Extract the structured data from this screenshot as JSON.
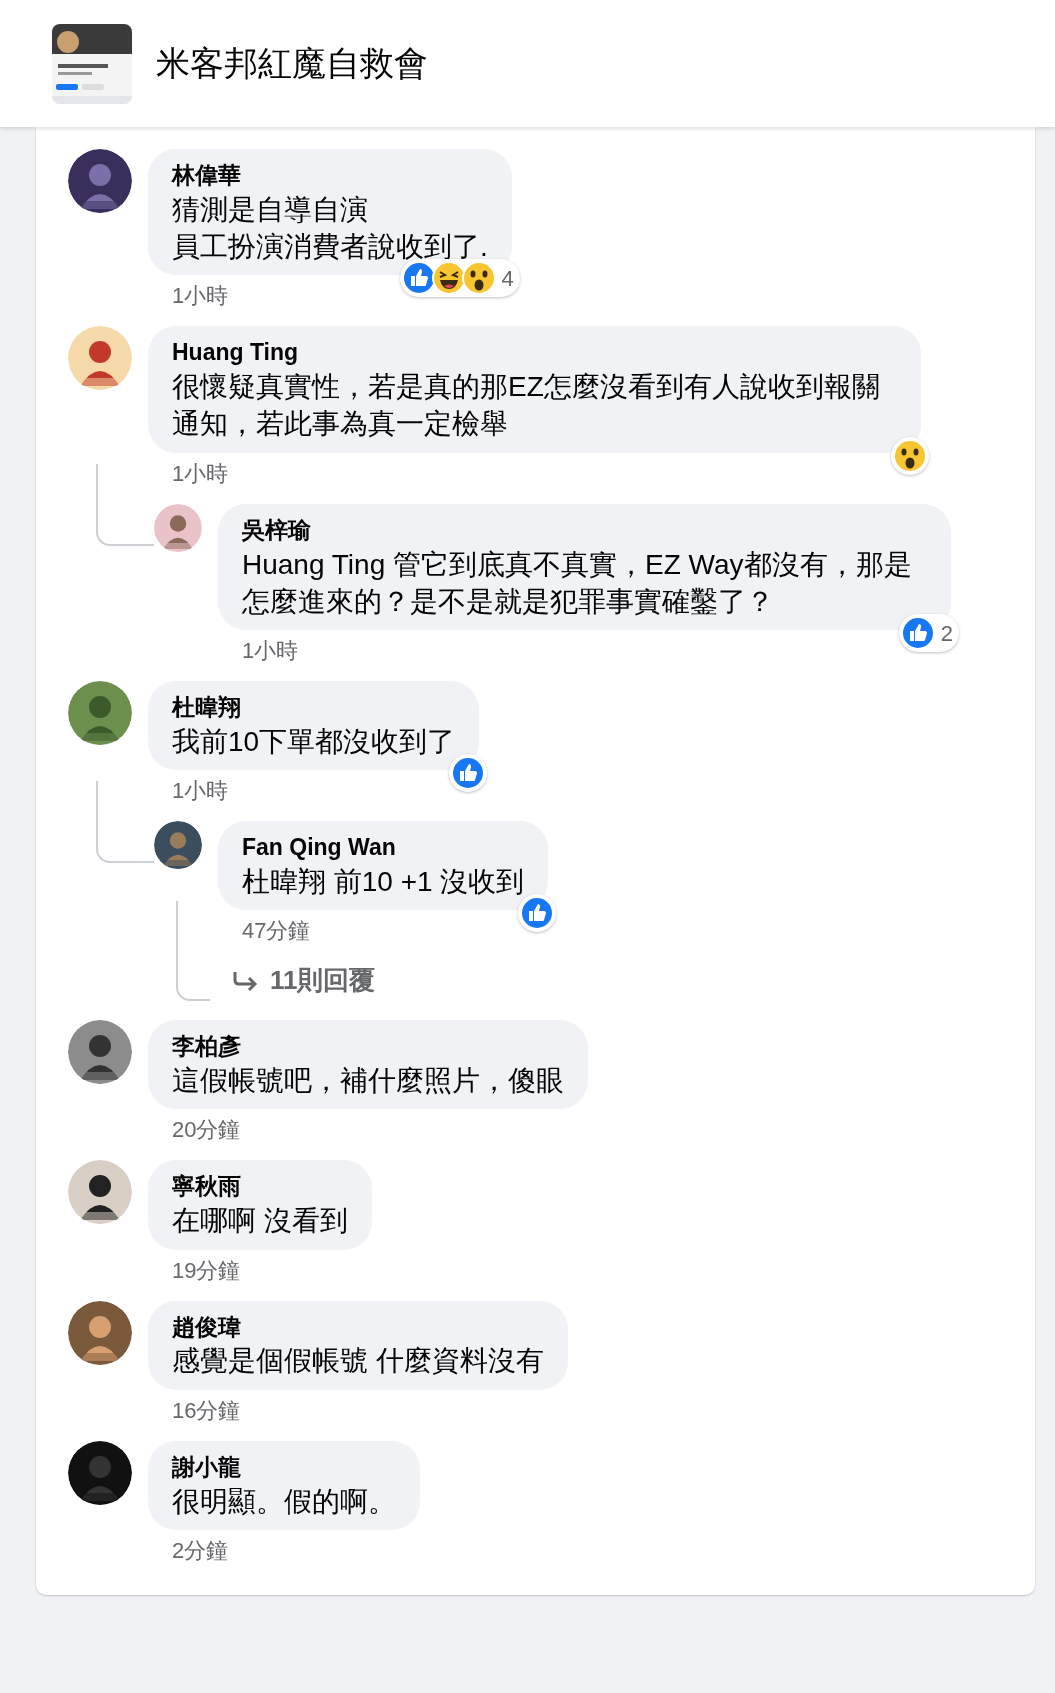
{
  "header": {
    "group_name": "米客邦紅魔自救會"
  },
  "comments": [
    {
      "author": "林偉華",
      "lines": [
        "猜測是自導自演",
        "員工扮演消費者說收到了."
      ],
      "time": "1小時",
      "reactions": {
        "icons": [
          {
            "kind": "like"
          },
          {
            "kind": "haha"
          },
          {
            "kind": "wow"
          }
        ],
        "count": "4"
      }
    },
    {
      "author": "Huang Ting",
      "text": "很懷疑真實性，若是真的那EZ怎麼沒看到有人說收到報關通知，若此事為真一定檢舉",
      "time": "1小時",
      "reactions": {
        "icons": [
          {
            "kind": "wow"
          }
        ]
      },
      "replies": [
        {
          "author": "吳梓瑜",
          "text": "Huang Ting 管它到底真不真實，EZ Way都沒有，那是怎麼進來的？是不是就是犯罪事實確鑿了？",
          "time": "1小時",
          "reactions": {
            "icons": [
              {
                "kind": "like"
              }
            ],
            "count": "2"
          }
        }
      ]
    },
    {
      "author": "杜暐翔",
      "text": "我前10下單都沒收到了",
      "time": "1小時",
      "reactions": {
        "icons": [
          {
            "kind": "like"
          }
        ]
      },
      "replies": [
        {
          "author": "Fan Qing Wan",
          "text": "杜暐翔 前10 +1 沒收到",
          "time": "47分鐘",
          "reactions": {
            "icons": [
              {
                "kind": "like"
              }
            ]
          }
        }
      ],
      "more_replies": "11則回覆"
    },
    {
      "author": "李柏彥",
      "text": "這假帳號吧，補什麼照片，傻眼",
      "time": "20分鐘"
    },
    {
      "author": "寧秋雨",
      "text": "在哪啊 沒看到",
      "time": "19分鐘"
    },
    {
      "author": "趙俊瑋",
      "text": "感覺是個假帳號 什麼資料沒有",
      "time": "16分鐘"
    },
    {
      "author": "謝小龍",
      "text": "很明顯。假的啊。",
      "time": "2分鐘"
    }
  ]
}
